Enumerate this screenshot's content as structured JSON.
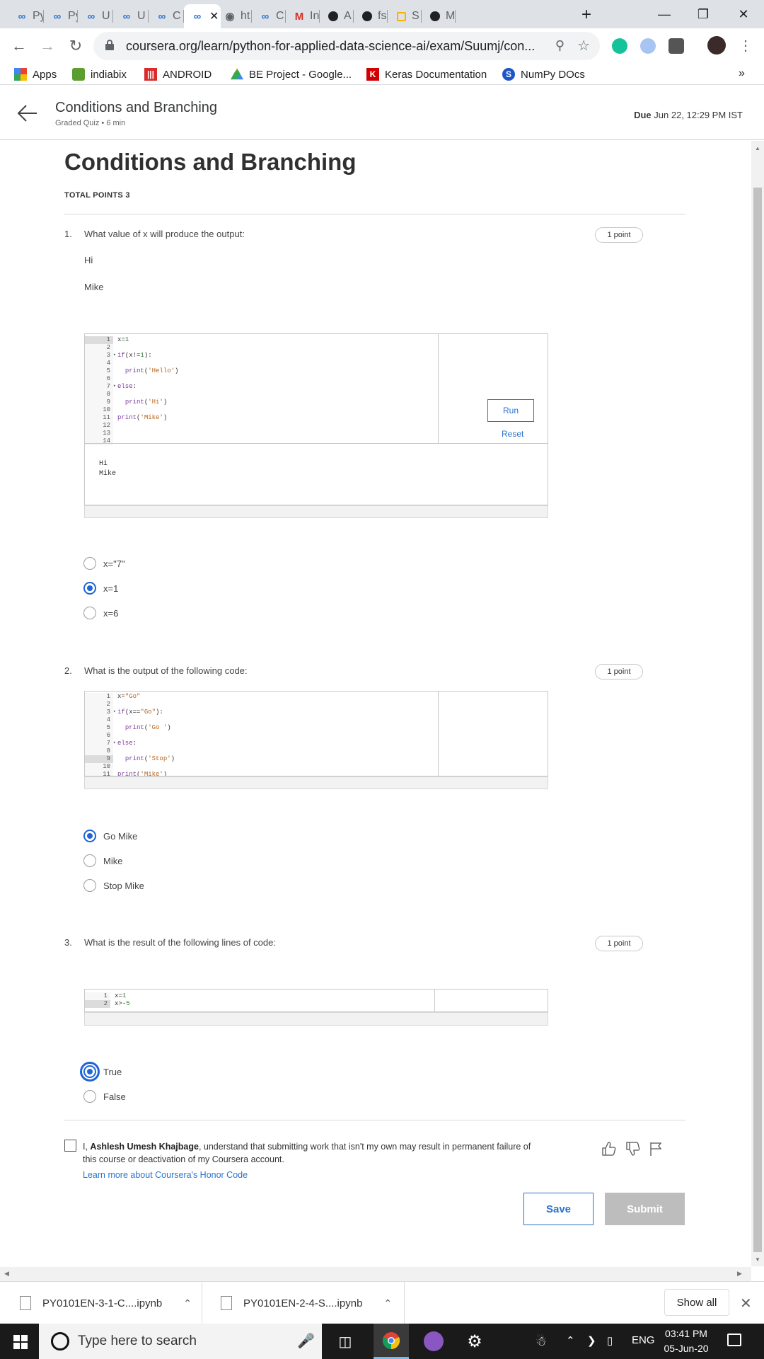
{
  "browser": {
    "tabs": [
      {
        "label": "Py",
        "icon": "coursera-icon"
      },
      {
        "label": "Py",
        "icon": "coursera-icon"
      },
      {
        "label": "U",
        "icon": "coursera-icon"
      },
      {
        "label": "U",
        "icon": "coursera-icon"
      },
      {
        "label": "C",
        "icon": "coursera-icon"
      },
      {
        "label": "",
        "icon": "coursera-icon",
        "active": true
      },
      {
        "label": "ht",
        "icon": "globe-icon"
      },
      {
        "label": "C",
        "icon": "coursera-icon"
      },
      {
        "label": "In",
        "icon": "gmail-icon"
      },
      {
        "label": "A",
        "icon": "github-icon"
      },
      {
        "label": "fs",
        "icon": "github-icon"
      },
      {
        "label": "S",
        "icon": "note-icon"
      },
      {
        "label": "M",
        "icon": "github-icon"
      }
    ],
    "new_tab": "+",
    "url": "coursera.org/learn/python-for-applied-data-science-ai/exam/Suumj/con...",
    "bookmarks": [
      {
        "label": "Apps",
        "icon": "apps-grid-icon"
      },
      {
        "label": "indiabix",
        "icon": "indiabix-icon"
      },
      {
        "label": "ANDROID",
        "icon": "android-icon"
      },
      {
        "label": "BE Project - Google...",
        "icon": "google-drive-icon"
      },
      {
        "label": "Keras Documentation",
        "icon": "keras-icon"
      },
      {
        "label": "NumPy DOcs",
        "icon": "numpy-icon"
      }
    ],
    "bookmarks_overflow": "»"
  },
  "header": {
    "title": "Conditions and Branching",
    "subtitle": "Graded Quiz • 6 min",
    "due_label": "Due",
    "due_value": "Jun 22, 12:29 PM IST"
  },
  "quiz": {
    "title": "Conditions and Branching",
    "total_points": "TOTAL POINTS 3",
    "questions": [
      {
        "number": "1.",
        "text": "What value of x will produce the output:",
        "points": "1 point",
        "lines": [
          "Hi",
          "Mike"
        ],
        "code_line_numbers": [
          "1",
          "2",
          "3",
          "4",
          "5",
          "6",
          "7",
          "8",
          "9",
          "10",
          "11",
          "12",
          "13",
          "14"
        ],
        "code": [
          "x=1",
          "",
          "if(x!=1):",
          "",
          "  print('Hello')",
          "",
          "else:",
          "",
          "  print('Hi')",
          "",
          "print('Mike')",
          "",
          "",
          ""
        ],
        "run_label": "Run",
        "reset_label": "Reset",
        "output": [
          "Hi",
          "Mike"
        ],
        "options": [
          {
            "label": "x=\"7\"",
            "selected": false
          },
          {
            "label": "x=1",
            "selected": true
          },
          {
            "label": "x=6",
            "selected": false
          }
        ]
      },
      {
        "number": "2.",
        "text": "What is the output of the following code:",
        "points": "1 point",
        "code_line_numbers": [
          "1",
          "2",
          "3",
          "4",
          "5",
          "6",
          "7",
          "8",
          "9",
          "10",
          "11"
        ],
        "code": [
          "x=\"Go\"",
          "",
          "if(x==\"Go\"):",
          "",
          "  print('Go ')",
          "",
          "else:",
          "",
          "  print('Stop')",
          "",
          "print('Mike')"
        ],
        "options": [
          {
            "label": "Go Mike",
            "selected": true
          },
          {
            "label": "Mike",
            "selected": false
          },
          {
            "label": "Stop Mike",
            "selected": false
          }
        ]
      },
      {
        "number": "3.",
        "text": "What is the result of the following lines of code:",
        "points": "1 point",
        "code_line_numbers": [
          "1",
          "2"
        ],
        "code": [
          "x=1",
          "x>-5"
        ],
        "options": [
          {
            "label": "True",
            "selected": true
          },
          {
            "label": "False",
            "selected": false
          }
        ]
      }
    ]
  },
  "honor": {
    "prefix": "I, ",
    "name": "Ashlesh Umesh Khajbage",
    "suffix": ", understand that submitting work that isn't my own may result in permanent failure of this course or deactivation of my Coursera account.",
    "link": "Learn more about Coursera's Honor Code"
  },
  "actions": {
    "save": "Save",
    "submit": "Submit"
  },
  "downloads": {
    "items": [
      "PY0101EN-3-1-C....ipynb",
      "PY0101EN-2-4-S....ipynb"
    ],
    "show_all": "Show all"
  },
  "taskbar": {
    "search_placeholder": "Type here to search",
    "language": "ENG",
    "time": "03:41 PM",
    "date": "05-Jun-20"
  },
  "colors": {
    "accent": "#1f65d6",
    "link": "#2a73cc",
    "submit_disabled": "#bdbdbd"
  }
}
